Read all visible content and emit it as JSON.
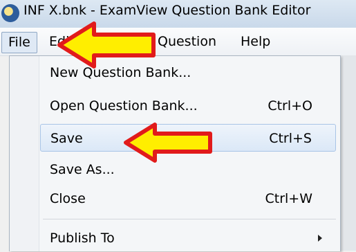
{
  "window": {
    "title": "INF X.bnk - ExamView Question Bank Editor",
    "icon": "examview-app-icon"
  },
  "menubar": {
    "file": "File",
    "edit": "Edit",
    "question": "Question",
    "help": "Help"
  },
  "file_menu": {
    "items": [
      {
        "label": "New Question Bank...",
        "shortcut": ""
      },
      {
        "label": "Open Question Bank...",
        "shortcut": "Ctrl+O"
      },
      {
        "label": "Save",
        "shortcut": "Ctrl+S",
        "highlighted": true
      },
      {
        "label": "Save As...",
        "shortcut": ""
      },
      {
        "label": "Close",
        "shortcut": "Ctrl+W"
      },
      {
        "label": "Publish To",
        "shortcut": "",
        "submenu": true
      }
    ]
  },
  "annotations": {
    "arrow_color": "#ffee00",
    "arrow_outline": "#e11b1b"
  }
}
